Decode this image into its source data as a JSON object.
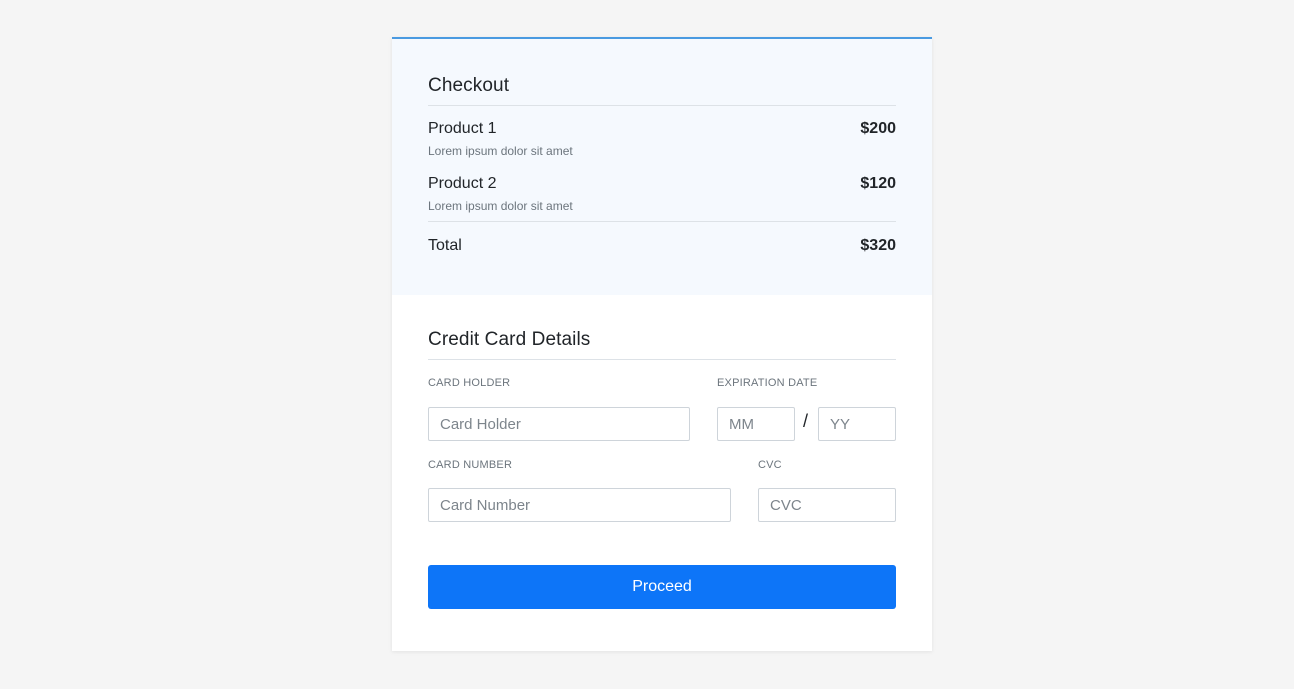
{
  "checkout": {
    "title": "Checkout",
    "items": [
      {
        "name": "Product 1",
        "description": "Lorem ipsum dolor sit amet",
        "price": "$200"
      },
      {
        "name": "Product 2",
        "description": "Lorem ipsum dolor sit amet",
        "price": "$120"
      }
    ],
    "total_label": "Total",
    "total_value": "$320"
  },
  "card_details": {
    "title": "Credit Card Details",
    "card_holder": {
      "label": "Card Holder",
      "placeholder": "Card Holder",
      "value": ""
    },
    "expiration": {
      "label": "Expiration Date",
      "month_placeholder": "MM",
      "year_placeholder": "YY",
      "separator": "/"
    },
    "card_number": {
      "label": "Card Number",
      "placeholder": "Card Number",
      "value": ""
    },
    "cvc": {
      "label": "CVC",
      "placeholder": "CVC",
      "value": ""
    },
    "proceed_label": "Proceed"
  },
  "colors": {
    "accent": "#0d75f8",
    "top_border": "#4a9ae1",
    "summary_bg": "#f5f9fe",
    "page_bg": "#f5f5f5"
  }
}
